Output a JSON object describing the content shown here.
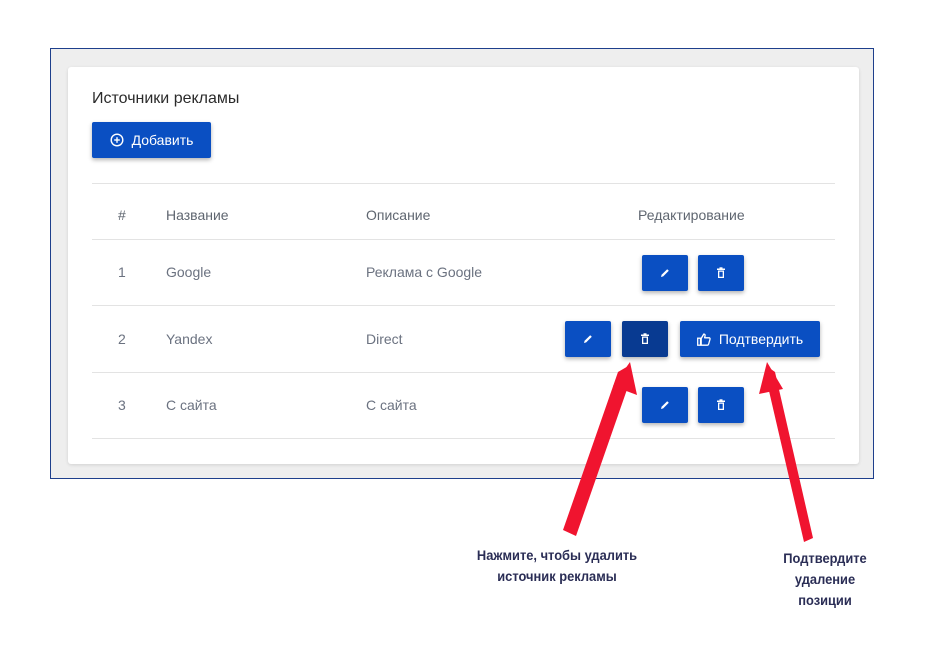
{
  "card": {
    "title": "Источники рекламы",
    "add_label": "Добавить"
  },
  "table": {
    "headers": [
      "#",
      "Название",
      "Описание",
      "Редактирование"
    ],
    "rows": [
      {
        "num": "1",
        "name": "Google",
        "description": "Реклама с Google"
      },
      {
        "num": "2",
        "name": "Yandex",
        "description": "Direct"
      },
      {
        "num": "3",
        "name": "С сайта",
        "description": "С сайта"
      }
    ],
    "confirm_label": "Подтвердить"
  },
  "annotations": {
    "delete_line1": "Нажмите, чтобы удалить",
    "delete_line2": "источник рекламы",
    "confirm_line1": "Подтвердите",
    "confirm_line2": "удаление",
    "confirm_line3": "позиции"
  },
  "icons": {
    "add": "plus-circle-icon",
    "edit": "pencil-icon",
    "delete": "trash-icon",
    "confirm": "thumbs-up-icon",
    "annotation_arrow": "arrow-icon"
  },
  "colors": {
    "primary": "#0a4fc2",
    "primary_active": "#083a91",
    "frame_border": "#1e3f8c",
    "annotation_arrow": "#f0142f",
    "annotation_text": "#2a2d55"
  }
}
